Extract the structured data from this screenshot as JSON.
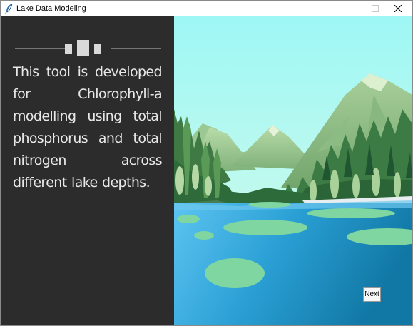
{
  "window": {
    "title": "Lake Data Modeling",
    "controls": [
      "minimize",
      "maximize",
      "close"
    ],
    "app_icon": "feather-icon"
  },
  "left_panel": {
    "description": "This tool is developed for Chlorophyll-a modelling using total phosphorus and total nitrogen across different lake depths.",
    "background_color": "#2c2c2c",
    "text_color": "#e8e8e8"
  },
  "scene": {
    "image": "lake-mountain-illustration",
    "sky_color": "#a2f5f2",
    "water_color": "#2e9fd6"
  },
  "buttons": {
    "next_label": "Next"
  }
}
